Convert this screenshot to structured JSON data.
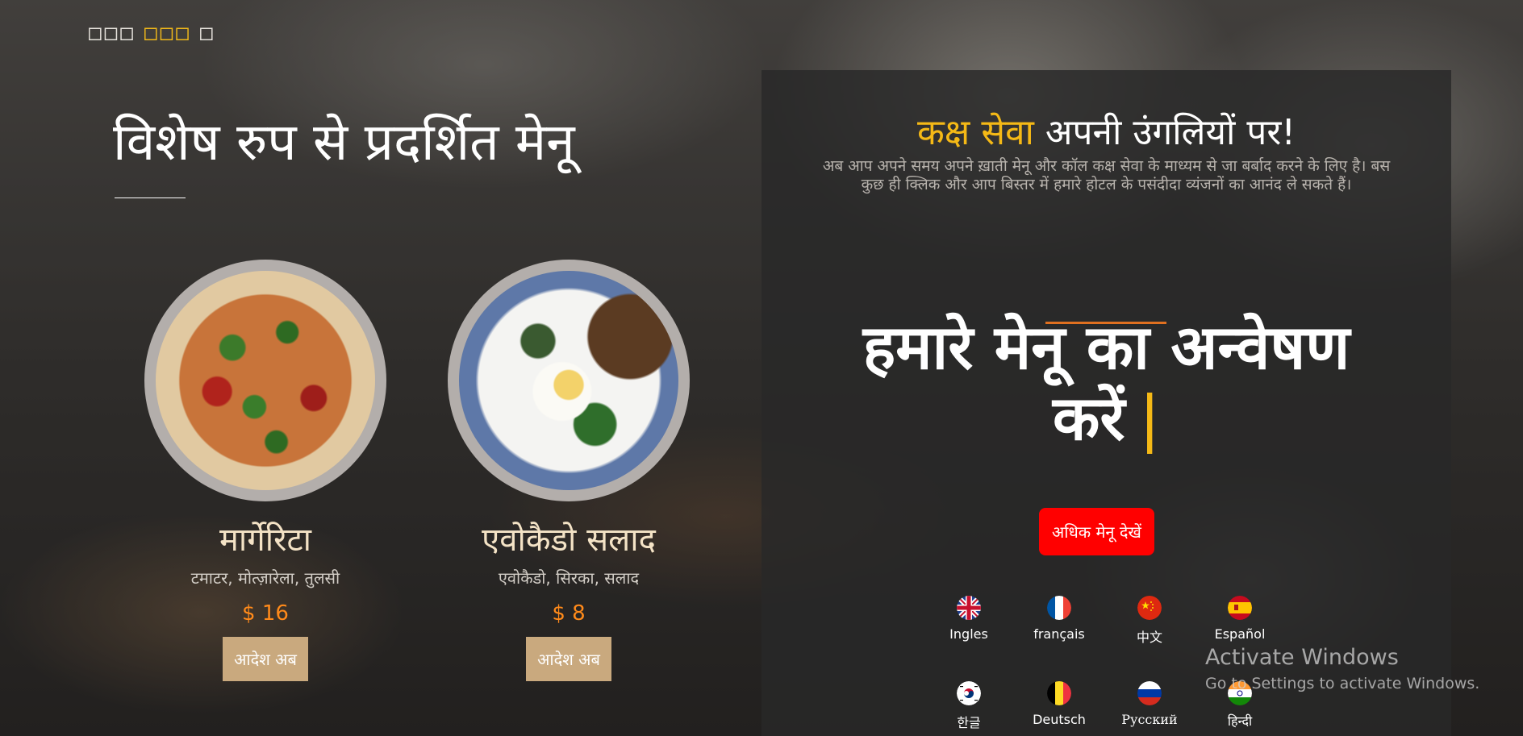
{
  "logo": {
    "part1": "□□□",
    "part2": "□□□",
    "part3": "□"
  },
  "featured": {
    "title": "विशेष रुप से प्रदर्शित मेनू",
    "items": [
      {
        "name": "मार्गेरिटा",
        "ingredients": "टमाटर, मोत्ज़ारेला, तुलसी",
        "price": "$ 16",
        "order_label": "आदेश अब",
        "image": "pizza-image"
      },
      {
        "name": "एवोकैडो सलाद",
        "ingredients": "एवोकैडो, सिरका, सलाद",
        "price": "$ 8",
        "order_label": "आदेश अब",
        "image": "avocado-salad-image"
      }
    ]
  },
  "panel": {
    "title_highlight": "कक्ष सेवा",
    "title_rest": " अपनी उंगलियों पर!",
    "description": "अब आप अपने समय अपने ख़ाती मेनू और कॉल कक्ष सेवा के माध्यम से जा बर्बाद करने के लिए है। बस कुछ ही क्लिक और आप बिस्तर में हमारे होटल के पसंदीदा व्यंजनों का आनंद ले सकते हैं।",
    "explore_line1": "हमारे मेनू का अन्वेषण",
    "explore_line2": "करें",
    "caret": "|",
    "more_button": "अधिक मेनू देखें",
    "languages": [
      {
        "label": "Ingles",
        "flag": "uk-flag-icon"
      },
      {
        "label": "français",
        "flag": "france-flag-icon"
      },
      {
        "label": "中文",
        "flag": "china-flag-icon"
      },
      {
        "label": "Español",
        "flag": "spain-flag-icon"
      },
      {
        "label": "한글",
        "flag": "korea-flag-icon"
      },
      {
        "label": "Deutsch",
        "flag": "belgium-flag-icon"
      },
      {
        "label": "Русский",
        "flag": "russia-flag-icon"
      },
      {
        "label": "हिन्दी",
        "flag": "india-flag-icon"
      }
    ]
  },
  "watermark": {
    "line1": "Activate Windows",
    "line2": "Go to Settings to activate Windows."
  },
  "colors": {
    "accent": "#f5b916",
    "price": "#ff8a1a",
    "order_button": "#c9a97e",
    "more_button": "#ff0000"
  }
}
